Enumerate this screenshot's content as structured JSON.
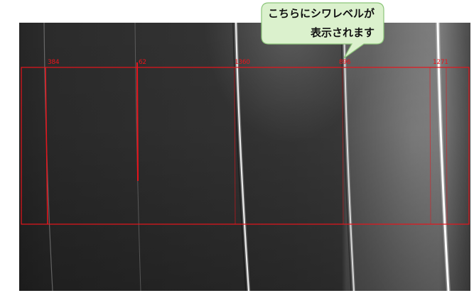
{
  "callout": {
    "line1": "こちらにシワレベルが",
    "line2": "表示されます"
  },
  "wrinkle_levels": [
    "384",
    "62",
    "1360",
    "896",
    "1271"
  ],
  "colors": {
    "roi": "#e8141c",
    "callout_fill": "#dbf1cd",
    "callout_border": "#8cc57a",
    "callout_text": "#111111"
  }
}
